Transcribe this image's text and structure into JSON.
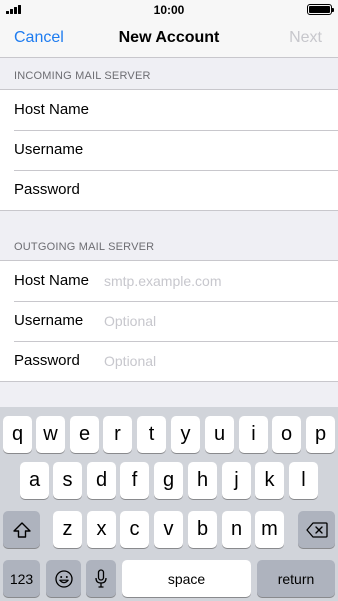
{
  "status_bar": {
    "time": "10:00"
  },
  "nav": {
    "cancel": "Cancel",
    "title": "New Account",
    "next": "Next"
  },
  "incoming": {
    "header": "INCOMING MAIL SERVER",
    "rows": [
      {
        "label": "Host Name",
        "value": ""
      },
      {
        "label": "Username",
        "value": ""
      },
      {
        "label": "Password",
        "value": ""
      }
    ]
  },
  "outgoing": {
    "header": "OUTGOING MAIL SERVER",
    "rows": [
      {
        "label": "Host Name",
        "placeholder": "smtp.example.com"
      },
      {
        "label": "Username",
        "placeholder": "Optional"
      },
      {
        "label": "Password",
        "placeholder": "Optional"
      }
    ]
  },
  "keyboard": {
    "row1": [
      "q",
      "w",
      "e",
      "r",
      "t",
      "y",
      "u",
      "i",
      "o",
      "p"
    ],
    "row2": [
      "a",
      "s",
      "d",
      "f",
      "g",
      "h",
      "j",
      "k",
      "l"
    ],
    "row3": [
      "z",
      "x",
      "c",
      "v",
      "b",
      "n",
      "m"
    ],
    "numbers": "123",
    "space": "space",
    "return": "return",
    "icons": {
      "shift": "shift-icon",
      "backspace": "backspace-icon",
      "emoji": "emoji-icon",
      "mic": "microphone-icon"
    }
  }
}
